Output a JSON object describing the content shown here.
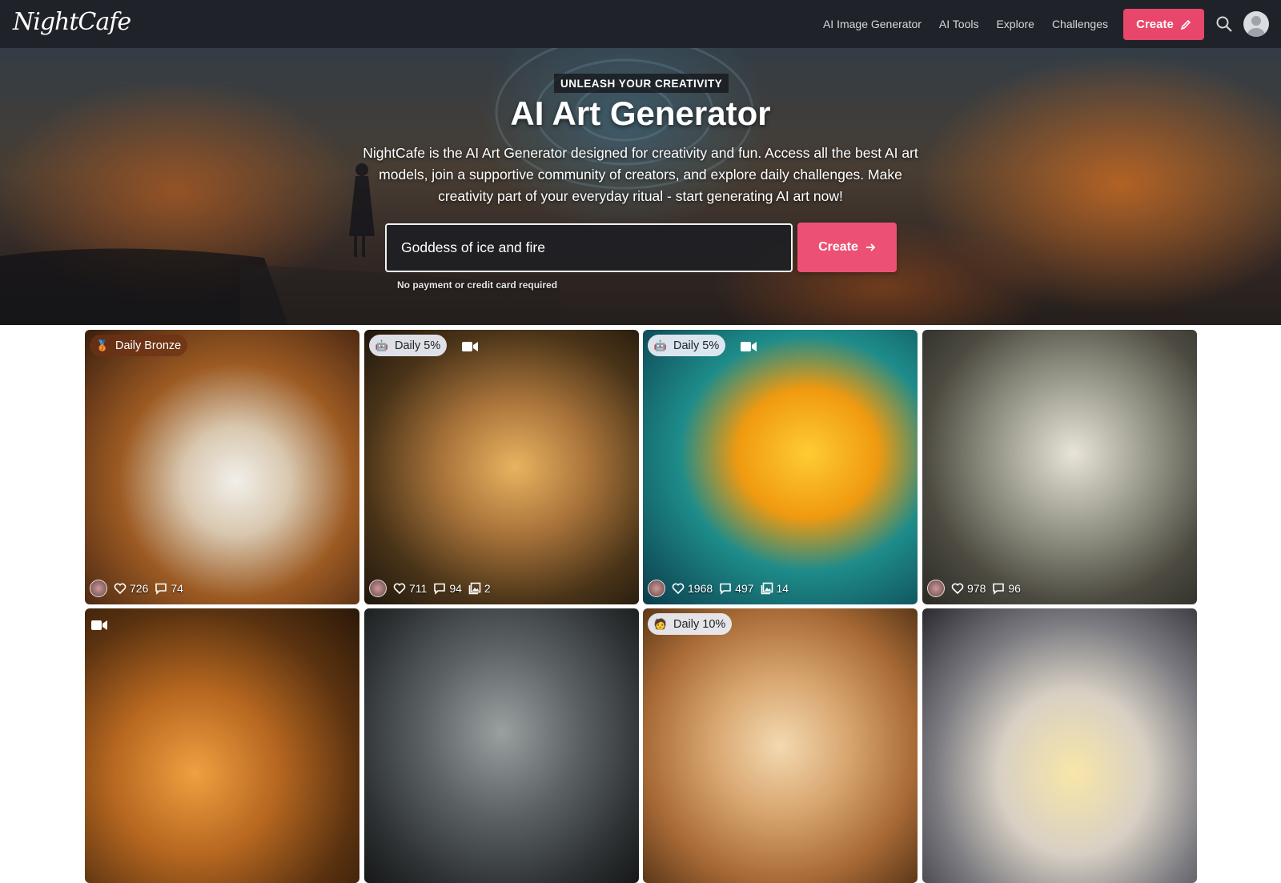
{
  "nav": {
    "logo": "NightCafe",
    "links": [
      "AI Image Generator",
      "AI Tools",
      "Explore",
      "Challenges"
    ],
    "create_label": "Create"
  },
  "hero": {
    "eyebrow": "UNLEASH YOUR CREATIVITY",
    "title": "AI Art Generator",
    "description": "NightCafe is the AI Art Generator designed for creativity and fun. Access all the best AI art models, join a supportive community of creators, and explore daily challenges. Make creativity part of your everyday ritual - start generating AI art now!",
    "prompt_value": "Goddess of ice and fire",
    "create_label": "Create",
    "note": "No payment or credit card required"
  },
  "colors": {
    "nav_bg": "#1f2329",
    "accent": "#e8466a",
    "accent_hero": "#ec5175"
  },
  "cards": [
    {
      "badge": "Daily Bronze",
      "badge_icon": "bronze-medal-icon",
      "video": false,
      "likes": "726",
      "comments": "74",
      "images": null
    },
    {
      "badge": "Daily 5%",
      "badge_icon": "robot-icon",
      "video": true,
      "likes": "711",
      "comments": "94",
      "images": "2"
    },
    {
      "badge": "Daily 5%",
      "badge_icon": "robot-icon",
      "video": true,
      "likes": "1968",
      "comments": "497",
      "images": "14"
    },
    {
      "badge": null,
      "badge_icon": null,
      "video": false,
      "likes": "978",
      "comments": "96",
      "images": null
    },
    {
      "badge": null,
      "badge_icon": null,
      "video": true
    },
    {
      "badge": null,
      "badge_icon": null,
      "video": false
    },
    {
      "badge": "Daily 10%",
      "badge_icon": "person-icon",
      "video": false
    },
    {
      "badge": null,
      "badge_icon": null,
      "video": false
    }
  ]
}
